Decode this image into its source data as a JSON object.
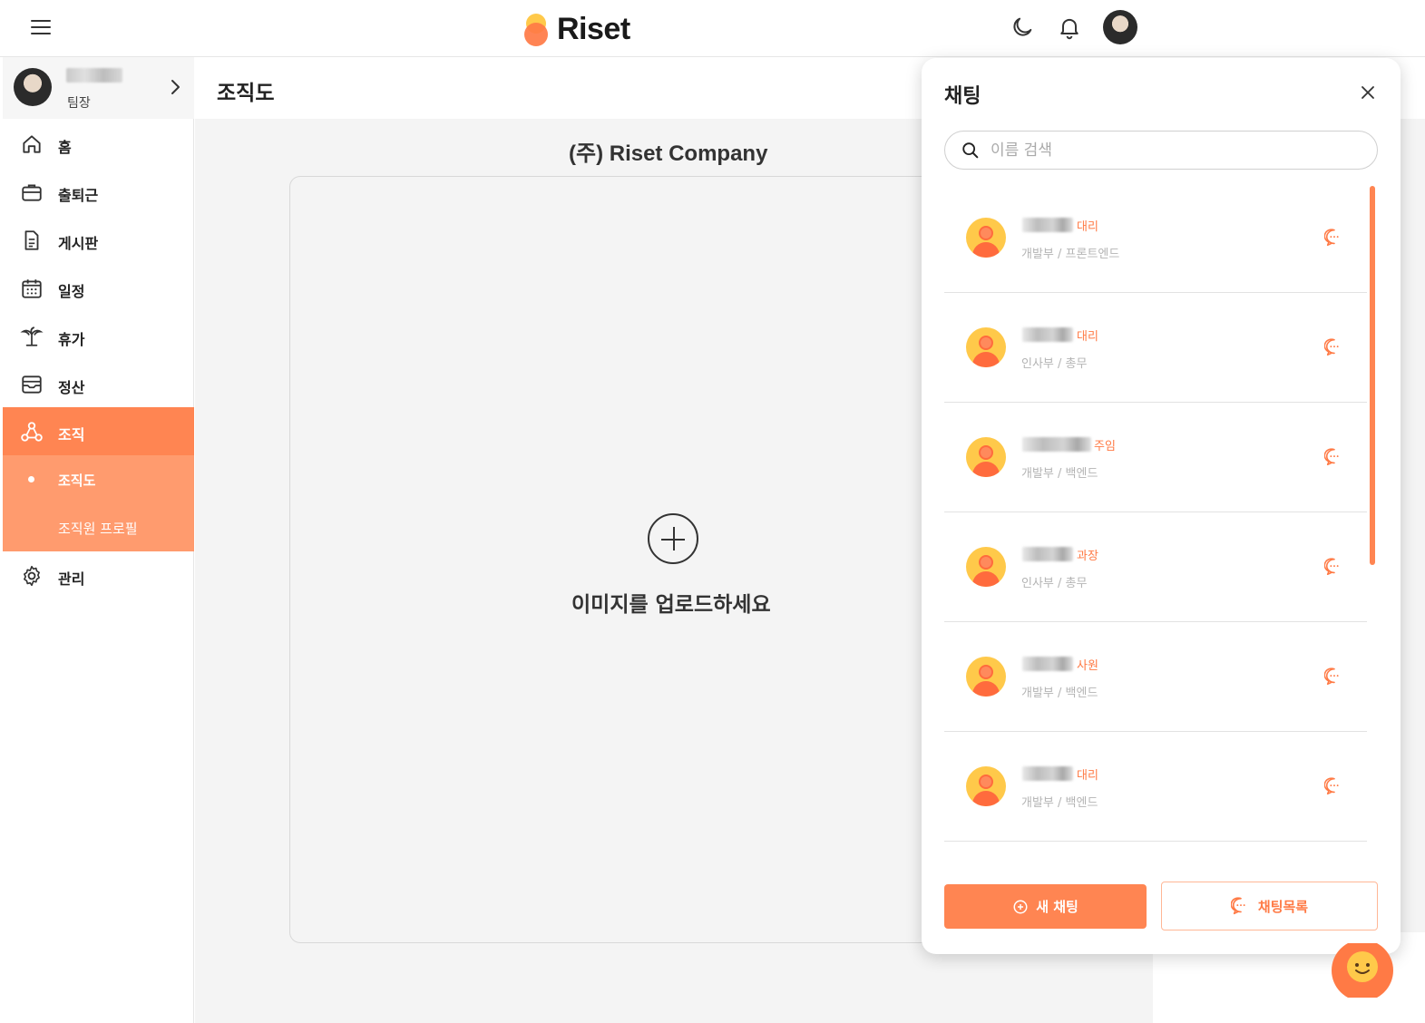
{
  "header": {
    "logo_text": "Riset",
    "icons": [
      "menu-icon",
      "moon-icon",
      "bell-icon",
      "user-avatar"
    ]
  },
  "sidebar": {
    "profile": {
      "role": "팀장"
    },
    "items": [
      {
        "label": "홈",
        "icon": "home-icon"
      },
      {
        "label": "출퇴근",
        "icon": "briefcase-icon"
      },
      {
        "label": "게시판",
        "icon": "document-icon"
      },
      {
        "label": "일정",
        "icon": "calendar-icon"
      },
      {
        "label": "휴가",
        "icon": "palm-tree-icon"
      },
      {
        "label": "정산",
        "icon": "archive-icon"
      },
      {
        "label": "조직",
        "icon": "org-icon",
        "active": true
      },
      {
        "label": "관리",
        "icon": "gear-icon"
      }
    ],
    "sub_items": [
      {
        "label": "조직도",
        "current": true
      },
      {
        "label": "조직원 프로필"
      }
    ]
  },
  "main": {
    "page_title": "조직도",
    "company_name": "(주) Riset Company",
    "upload_text": "이미지를 업로드하세요"
  },
  "chat": {
    "title": "채팅",
    "search_placeholder": "이름 검색",
    "contacts": [
      {
        "rank": "대리",
        "dept": "개발부 / 프론트엔드"
      },
      {
        "rank": "대리",
        "dept": "인사부 / 총무"
      },
      {
        "rank": "주임",
        "dept": "개발부 / 백엔드"
      },
      {
        "rank": "과장",
        "dept": "인사부 / 총무"
      },
      {
        "rank": "사원",
        "dept": "개발부 / 백엔드"
      },
      {
        "rank": "대리",
        "dept": "개발부 / 백엔드"
      }
    ],
    "new_chat_label": "새 채팅",
    "chat_list_label": "채팅목록"
  },
  "colors": {
    "accent": "#ff8552",
    "accent_light": "#ff9b6e",
    "avatar_bg": "#ffc94a"
  }
}
